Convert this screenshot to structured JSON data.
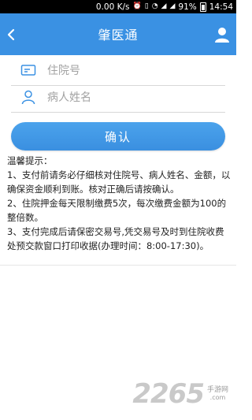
{
  "status_bar": {
    "speed": "0.00 K/s",
    "battery": "91%",
    "time": "14:54"
  },
  "app_bar": {
    "title": "肇医通"
  },
  "form": {
    "hospital_number_placeholder": "住院号",
    "patient_name_placeholder": "病人姓名",
    "confirm_label": "确认"
  },
  "tips": {
    "heading": "温馨提示：",
    "item1": "1、支付前请务必仔细核对住院号、病人姓名、金额，以确保资金顺利到账。核对正确后请按确认。",
    "item2": "2、住院押金每天限制缴费5次，每次缴费金额为100的整倍数。",
    "item3": "3、支付完成后请保密交易号,凭交易号及时到住院收费处预交款窗口打印收据(办理时间：8:00-17:30)。"
  },
  "watermark": {
    "number": "2265",
    "name": "手游网",
    "site": ".com"
  },
  "colors": {
    "app_bar": "#3a91e3",
    "button": "#4ba3ec",
    "icon": "#3a91e3"
  }
}
